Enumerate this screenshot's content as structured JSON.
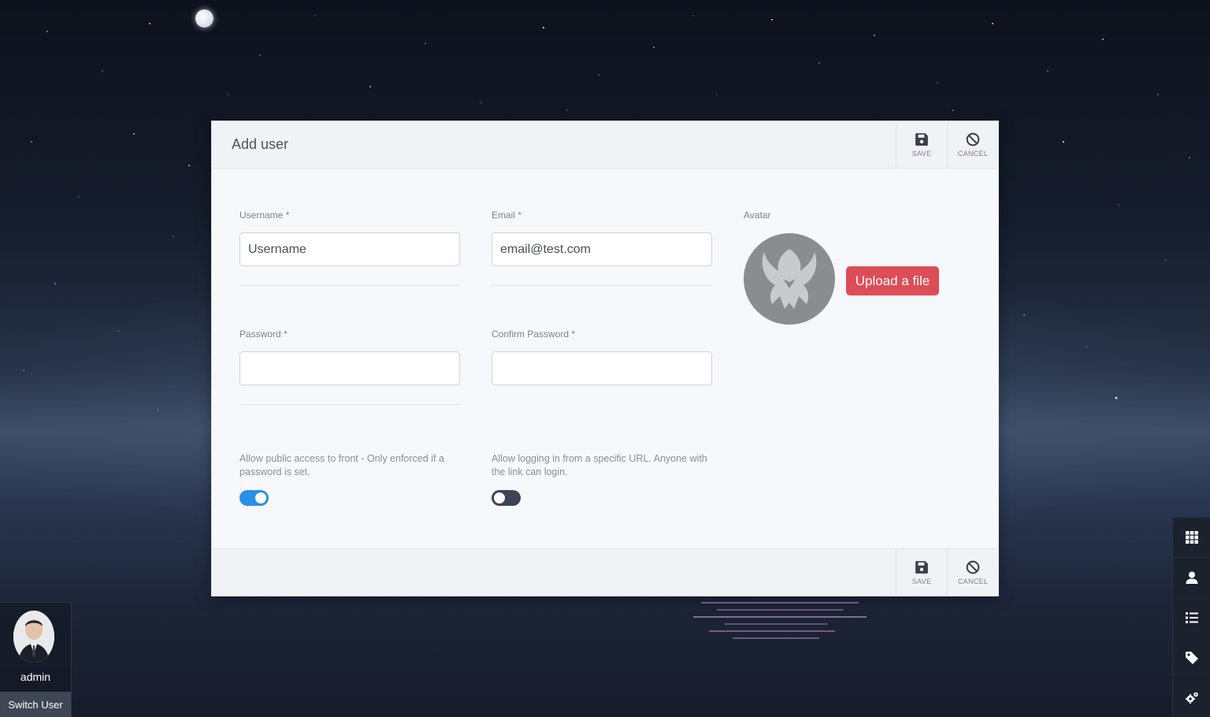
{
  "modal": {
    "title": "Add user",
    "header_actions": {
      "save_label": "SAVE",
      "cancel_label": "CANCEL"
    },
    "footer_actions": {
      "save_label": "SAVE",
      "cancel_label": "CANCEL"
    },
    "fields": {
      "username": {
        "label": "Username *",
        "placeholder": "Username",
        "value": ""
      },
      "email": {
        "label": "Email *",
        "placeholder": "email@test.com",
        "value": ""
      },
      "password": {
        "label": "Password *",
        "value": ""
      },
      "confirm_password": {
        "label": "Confirm Password *",
        "value": ""
      }
    },
    "avatar": {
      "label": "Avatar",
      "upload_label": "Upload a file"
    },
    "toggles": {
      "public_access": {
        "text": "Allow public access to front - Only enforced if a password is set.",
        "on": true
      },
      "url_login": {
        "text": "Allow logging in from a specific URL. Anyone with the link can login.",
        "on": false
      }
    }
  },
  "user_card": {
    "name": "admin",
    "switch_label": "Switch User"
  },
  "dock": {
    "items": [
      {
        "icon": "grid-icon"
      },
      {
        "icon": "user-icon"
      },
      {
        "icon": "list-icon"
      },
      {
        "icon": "tag-icon"
      },
      {
        "icon": "cogs-icon"
      }
    ]
  },
  "colors": {
    "upload_button": "#de4d57",
    "toggle_on": "#2a8fe6",
    "toggle_off": "#3d4554",
    "dock_background": "#1b212d"
  }
}
